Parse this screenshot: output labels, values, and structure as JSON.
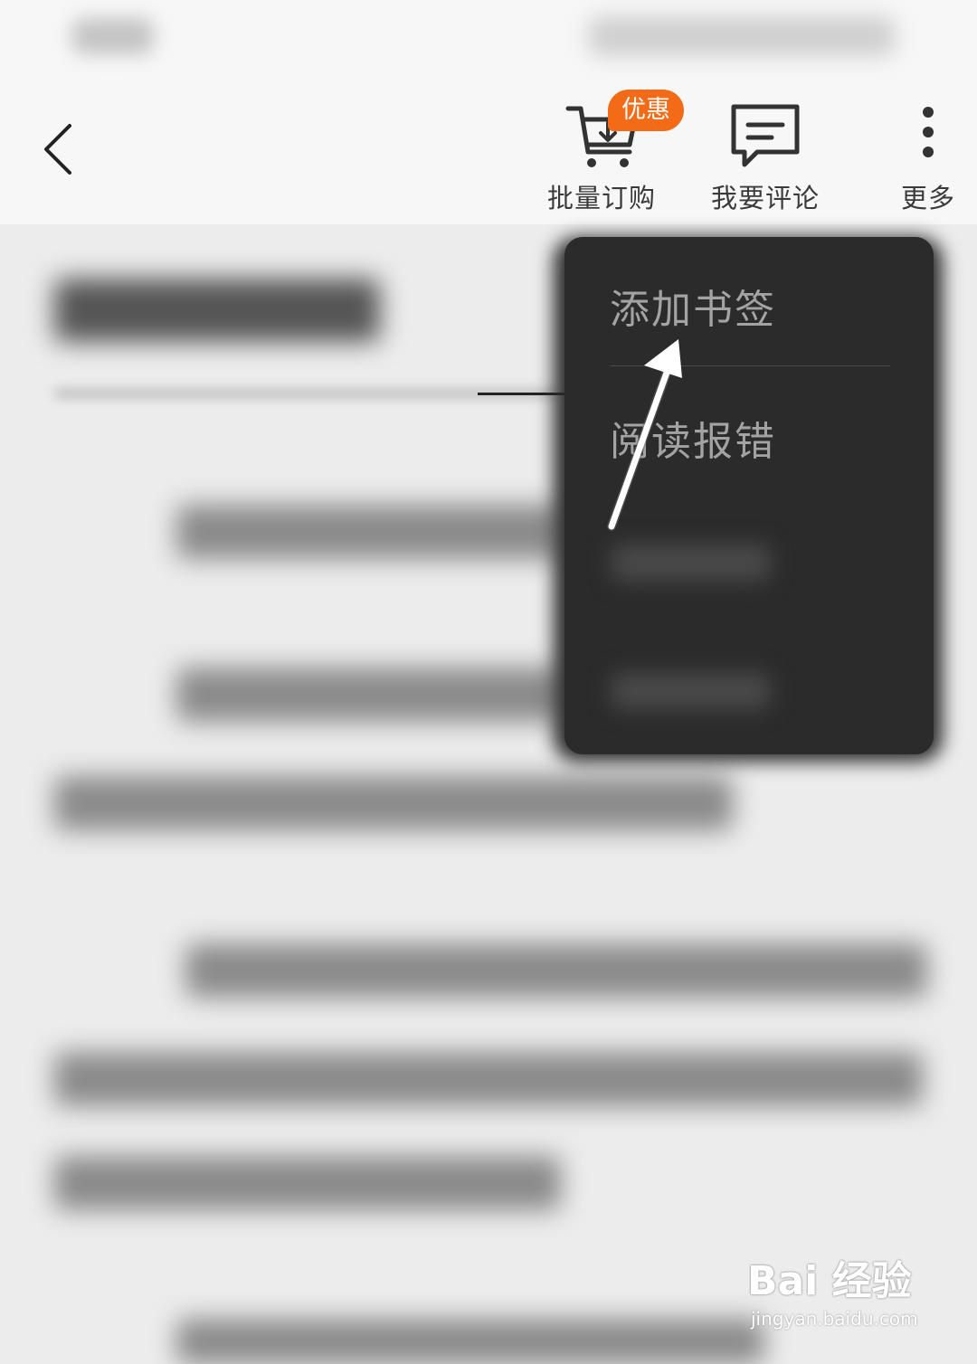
{
  "toolbar": {
    "back_icon": "chevron-left-icon",
    "batch_order": {
      "label": "批量订购",
      "icon": "cart-download-icon",
      "badge": "优惠",
      "badge_color": "#f46b17"
    },
    "comment": {
      "label": "我要评论",
      "icon": "comment-icon"
    },
    "more": {
      "label": "更多",
      "icon": "more-vertical-icon"
    }
  },
  "menu": {
    "items": [
      {
        "label": "添加书签"
      },
      {
        "label": "阅读报错"
      }
    ],
    "background": "#2b2b2b"
  },
  "watermark": {
    "logo": "Bai 经验",
    "url": "jingyan.baidu.com"
  }
}
